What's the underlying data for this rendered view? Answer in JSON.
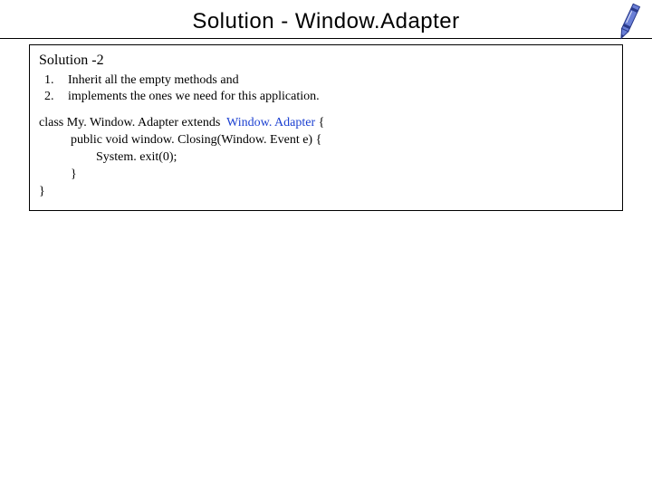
{
  "title": "Solution - Window.Adapter",
  "subtitle": "Solution -2",
  "list": {
    "n1": "1.",
    "t1": "Inherit all the empty methods and",
    "n2": "2.",
    "t2": "implements the ones we need for this application."
  },
  "code": {
    "l1a": "class My. Window. Adapter extends  ",
    "l1b": "Window. Adapter",
    "l1c": " {",
    "l2": "          public void window. Closing(Window. Event e) {",
    "l3": "                  System. exit(0);",
    "l4": "          }",
    "l5": "}"
  }
}
